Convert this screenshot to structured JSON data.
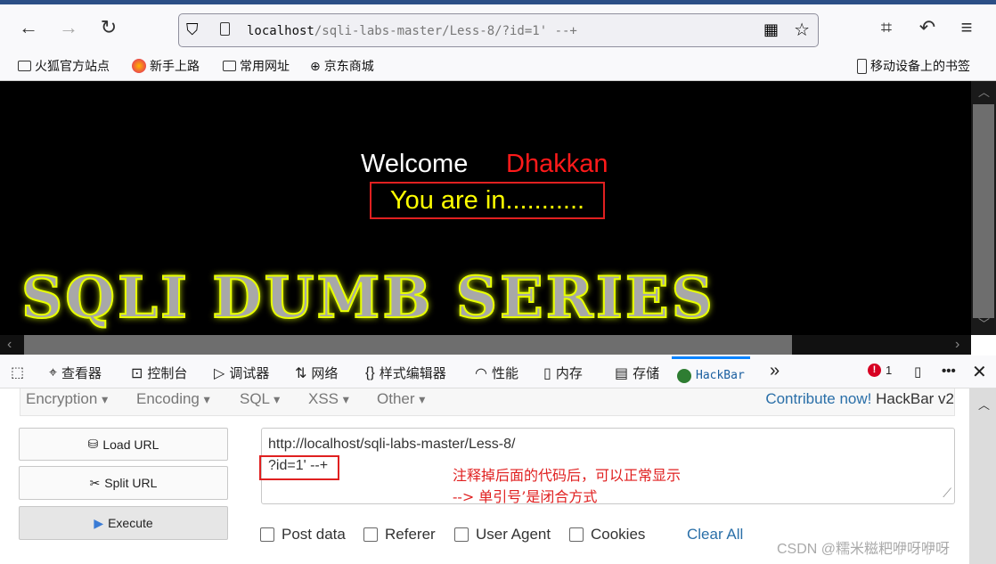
{
  "browser": {
    "url_host": "localhost",
    "url_path": "/sqli-labs-master/Less-8/?id=1' --+",
    "bookmarks": [
      "火狐官方站点",
      "新手上路",
      "常用网址",
      "京东商城"
    ],
    "mobile_bookmarks": "移动设备上的书签"
  },
  "page": {
    "welcome": "Welcome",
    "name": "Dhakkan",
    "status": "You are in...........",
    "banner": "SQLI DUMB SERIES"
  },
  "devtools": {
    "tabs": [
      "查看器",
      "控制台",
      "调试器",
      "网络",
      "样式编辑器",
      "性能",
      "内存",
      "存储",
      "HackBar"
    ],
    "error_count": "1"
  },
  "hackbar": {
    "menus": [
      "Encryption",
      "Encoding",
      "SQL",
      "XSS",
      "Other"
    ],
    "contribute": "Contribute now!",
    "version": "HackBar v2",
    "buttons": [
      "Load URL",
      "Split URL",
      "Execute"
    ],
    "url_line1": "http://localhost/sqli-labs-master/Less-8/",
    "url_line2": "?id=1' --+",
    "note1": "注释掉后面的代码后，可以正常显示",
    "note2": "--> 单引号’是闭合方式",
    "checkboxes": [
      "Post data",
      "Referer",
      "User Agent",
      "Cookies"
    ],
    "clear_all": "Clear All"
  },
  "watermark": "CSDN @糯米糍粑咿呀咿呀",
  "colors": {
    "accent": "#0a84ff",
    "annotation": "#e02020",
    "link": "#2a6fa8"
  }
}
